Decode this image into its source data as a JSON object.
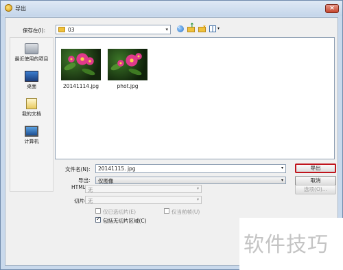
{
  "window": {
    "title": "导出",
    "close_glyph": "×"
  },
  "lookin": {
    "label": "保存在(I):",
    "value": "03",
    "arrow": "▾"
  },
  "toolbar": {
    "view_arrow": "▾"
  },
  "places": [
    {
      "label": "最近使用的项目",
      "icon": "recent-items-icon"
    },
    {
      "label": "桌面",
      "icon": "desktop-icon"
    },
    {
      "label": "我的文档",
      "icon": "documents-icon"
    },
    {
      "label": "计算机",
      "icon": "computer-icon"
    }
  ],
  "files": [
    {
      "name": "20141114.jpg"
    },
    {
      "name": "phot.jpg"
    }
  ],
  "form": {
    "filename_label": "文件名(N):",
    "filename_value": "20141115. jpg",
    "export_label": "导出:",
    "export_value": "仅图像",
    "html_label": "HTML(H):",
    "html_value": "无",
    "slices_label": "切片(L):",
    "slices_value": "无",
    "only_selected_slices": "仅已选切片(E)",
    "only_current_frame": "仅当前帧(U)",
    "include_areas": "包括无切片区域(C)",
    "include_areas_checked": true,
    "arrow": "▾"
  },
  "buttons": {
    "export": "导出",
    "cancel": "取消",
    "options": "选项(O)..."
  },
  "watermark": {
    "text": "软件技巧"
  },
  "colors": {
    "accent_red": "#c0141c",
    "window_frame": "#c9d9ec"
  }
}
